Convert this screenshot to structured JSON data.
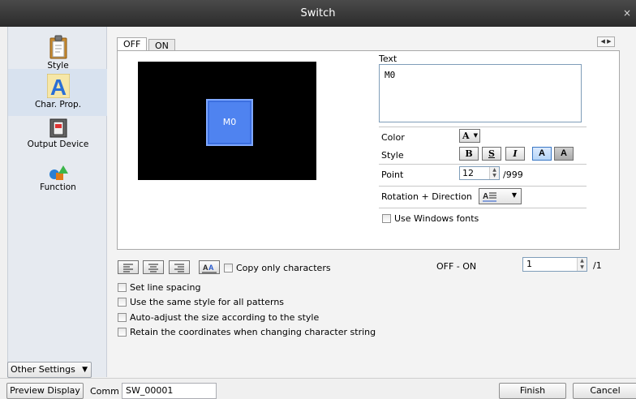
{
  "window": {
    "title": "Switch",
    "close": "×"
  },
  "sidebar": {
    "items": [
      {
        "label": "Style",
        "icon": "clipboard-icon"
      },
      {
        "label": "Char. Prop.",
        "icon": "letter-a-icon"
      },
      {
        "label": "Output Device",
        "icon": "lamp-device-icon"
      },
      {
        "label": "Function",
        "icon": "shapes-icon"
      }
    ],
    "selected": "Char. Prop.",
    "other_settings": "Other Settings"
  },
  "tabs": [
    {
      "label": "OFF",
      "active": true
    },
    {
      "label": "ON",
      "active": false
    }
  ],
  "preview": {
    "button_text": "M0",
    "button_color": "#4f83f0",
    "background": "#000000"
  },
  "text_section": {
    "label": "Text",
    "value": "M0"
  },
  "color": {
    "label": "Color",
    "value": "A"
  },
  "style": {
    "label": "Style",
    "buttons": [
      "B",
      "S",
      "I",
      "A",
      "A"
    ]
  },
  "point": {
    "label": "Point",
    "value": "12",
    "max": "/999"
  },
  "rotation": {
    "label": "Rotation + Direction"
  },
  "use_windows_fonts": {
    "label": "Use Windows fonts",
    "checked": false
  },
  "copy_only_chars": {
    "label": "Copy only characters",
    "checked": false
  },
  "offon": {
    "label": "OFF - ON",
    "value": "1",
    "total": "/1"
  },
  "options": [
    {
      "label": "Set line spacing",
      "checked": false
    },
    {
      "label": "Use the same style for all patterns",
      "checked": false
    },
    {
      "label": "Auto-adjust the size according to the style",
      "checked": false
    },
    {
      "label": "Retain the coordinates when changing character string",
      "checked": false
    }
  ],
  "bottom": {
    "preview_display": "Preview Display",
    "comm_label": "Comm",
    "comm_value": "SW_00001",
    "finish": "Finish",
    "cancel": "Cancel"
  }
}
